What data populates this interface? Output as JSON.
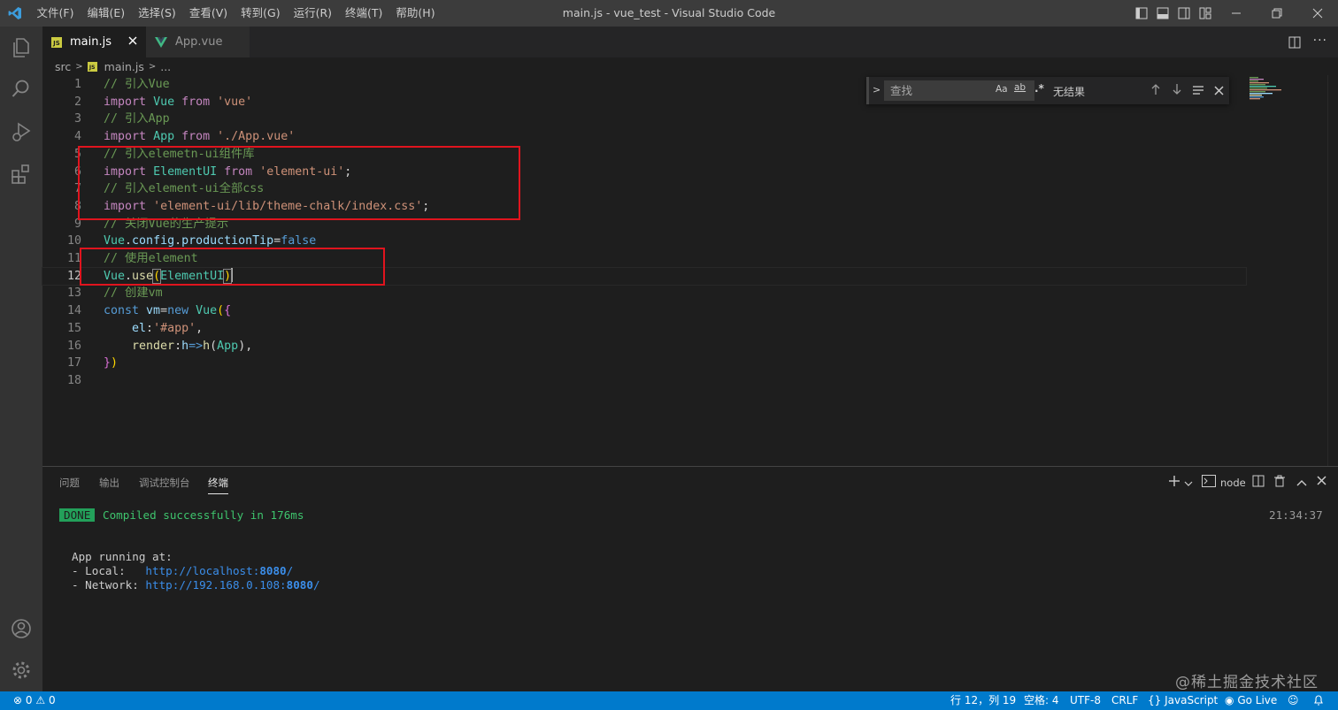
{
  "titlebar": {
    "menu": [
      "文件(F)",
      "编辑(E)",
      "选择(S)",
      "查看(V)",
      "转到(G)",
      "运行(R)",
      "终端(T)",
      "帮助(H)"
    ],
    "window_title": "main.js - vue_test - Visual Studio Code"
  },
  "tabs": [
    {
      "label": "main.js",
      "icon": "JS",
      "active": true
    },
    {
      "label": "App.vue",
      "icon": "vue-logo",
      "active": false
    }
  ],
  "breadcrumbs": {
    "folder": "src",
    "file": "main.js",
    "more": "..."
  },
  "editor": {
    "cursor_line": 12,
    "lines": [
      "// 引入Vue",
      "import Vue from 'vue'",
      "// 引入App",
      "import App from './App.vue'",
      "// 引入elemetn-ui组件库",
      "import ElementUI from 'element-ui';",
      "// 引入element-ui全部css",
      "import 'element-ui/lib/theme-chalk/index.css';",
      "// 关闭Vue的生产提示",
      "Vue.config.productionTip=false",
      "// 使用element",
      "Vue.use(ElementUI)",
      "// 创建vm",
      "const vm=new Vue({",
      "    el:'#app',",
      "    render:h=>h(App),",
      "})",
      ""
    ]
  },
  "find": {
    "placeholder": "查找",
    "match_case": "Aa",
    "whole_word": "ab",
    "regex": ".*",
    "result": "无结果"
  },
  "panel": {
    "tabs": [
      "问题",
      "输出",
      "调试控制台",
      "终端"
    ],
    "active_tab": "终端",
    "terminal_name": "node",
    "done_badge": "DONE",
    "compiled_msg": "Compiled successfully in 176ms",
    "time": "21:34:37",
    "running": "App running at:",
    "local_label": "- Local:   ",
    "local_url": "http://localhost:",
    "local_port": "8080",
    "network_label": "- Network: ",
    "network_url": "http://192.168.0.108:",
    "network_port": "8080",
    "slash": "/"
  },
  "statusbar": {
    "errors": "0",
    "warnings": "0",
    "position": "行 12，列 19",
    "spaces": "空格: 4",
    "encoding": "UTF-8",
    "eol": "CRLF",
    "language": "JavaScript",
    "golive": "Go Live"
  },
  "watermark": "@稀土掘金技术社区",
  "colors": {
    "accent": "#007acc",
    "annotation_box": "#e0141e",
    "done_badge": "#23a05a"
  }
}
